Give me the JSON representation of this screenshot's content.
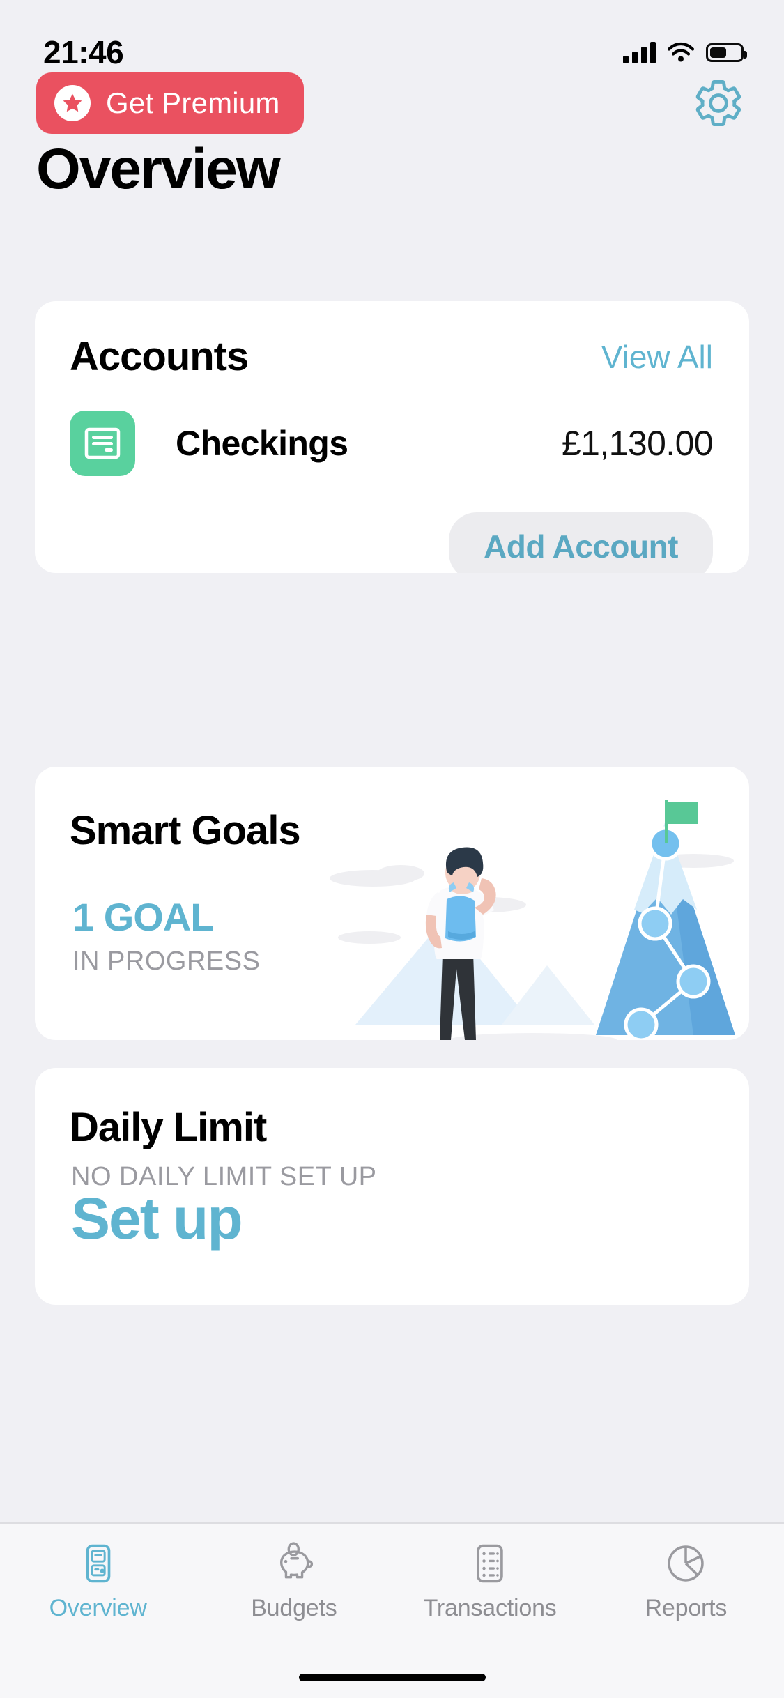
{
  "status_bar": {
    "time": "21:46",
    "signal_icon": "cellular-bars-icon",
    "wifi_icon": "wifi-icon",
    "battery_icon": "battery-icon"
  },
  "top_bar": {
    "premium_label": "Get Premium",
    "premium_icon": "star-badge-icon",
    "premium_color": "#EA5160",
    "settings_icon": "gear-icon",
    "settings_color": "#5FAEC6"
  },
  "page": {
    "title": "Overview",
    "background_color": "#F0F0F4",
    "accent_color": "#5FB4D0"
  },
  "accounts_card": {
    "title": "Accounts",
    "view_all_label": "View All",
    "add_account_label": "Add Account",
    "rows": [
      {
        "icon": "bank-card-icon",
        "icon_color": "#59D19E",
        "name": "Checkings",
        "amount": "£1,130.00"
      }
    ]
  },
  "smart_goals_card": {
    "title": "Smart Goals",
    "count_label": "1 GOAL",
    "status_label": "IN PROGRESS",
    "illustration": "mountain-climber-goal-illustration",
    "flag_color": "#58C896",
    "mountain_color": "#67AFE0"
  },
  "daily_limit_card": {
    "title": "Daily Limit",
    "status_label": "NO DAILY LIMIT SET UP",
    "action_label": "Set up"
  },
  "fab": {
    "icon": "plus-icon",
    "color": "#1E50B5"
  },
  "tab_bar": {
    "tabs": [
      {
        "label": "Overview",
        "icon": "overview-card-icon",
        "active": true
      },
      {
        "label": "Budgets",
        "icon": "piggy-bank-icon",
        "active": false
      },
      {
        "label": "Transactions",
        "icon": "list-lines-icon",
        "active": false
      },
      {
        "label": "Reports",
        "icon": "pie-chart-icon",
        "active": false
      }
    ]
  }
}
